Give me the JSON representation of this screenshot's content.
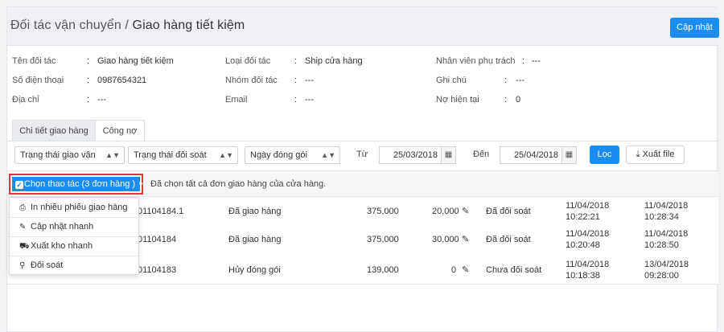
{
  "header": {
    "title_main": "Đối tác vận chuyển",
    "title_sep": " / ",
    "title_sub": "Giao hàng tiết kiệm",
    "update_button": "Cập nhật"
  },
  "info": {
    "partner_name": {
      "label": "Tên đối tác",
      "value": "Giao hàng tiết kiệm"
    },
    "phone": {
      "label": "Số điện thoại",
      "value": "0987654321"
    },
    "address": {
      "label": "Địa chỉ",
      "value": "---"
    },
    "partner_type": {
      "label": "Loại đối tác",
      "value": "Ship cửa hàng"
    },
    "partner_group": {
      "label": "Nhóm đối tác",
      "value": "---"
    },
    "email": {
      "label": "Email",
      "value": "---"
    },
    "staff": {
      "label": "Nhân viên phụ trách",
      "value": "---"
    },
    "note": {
      "label": "Ghi chú",
      "value": "---"
    },
    "debt": {
      "label": "Nợ hiện tại",
      "value": "0"
    },
    "colon": ":"
  },
  "tabs": [
    {
      "label": "Chi tiết giao hàng",
      "active": true
    },
    {
      "label": "Công nợ",
      "active": false
    }
  ],
  "filters": {
    "shipping_status": "Trạng thái giao vận",
    "reconcile_status": "Trạng thái đối soát",
    "pack_date": "Ngày đóng gói",
    "from_label": "Từ",
    "from_date": "25/03/2018",
    "to_label": "Đến",
    "to_date": "25/04/2018",
    "filter_button": "Lọc",
    "export_button": "Xuất file"
  },
  "actions": {
    "choose_label": "Chọn thao tác (3 đơn hàng )",
    "select_all_message": "Đã chọn tất cả đơn giao hàng của cửa hàng.",
    "menu": [
      {
        "label": "In nhiều phiếu giao hàng",
        "icon": "printer-icon"
      },
      {
        "label": "Cập nhật nhanh",
        "icon": "edit-icon"
      },
      {
        "label": "Xuất kho nhanh",
        "icon": "truck-icon"
      },
      {
        "label": "Đối soát",
        "icon": "search-icon"
      }
    ]
  },
  "rows": [
    {
      "code": "01104184.1",
      "status": "Đã giao hàng",
      "amount": "375,000",
      "fee": "20,000",
      "reconcile": "Đã đối soát",
      "date1": "11/04/2018",
      "time1": "10:22:21",
      "date2": "11/04/2018",
      "time2": "10:28:34"
    },
    {
      "code": "01104184",
      "status": "Đã giao hàng",
      "amount": "375,000",
      "fee": "30,000",
      "reconcile": "Đã đối soát",
      "date1": "11/04/2018",
      "time1": "10:20:48",
      "date2": "11/04/2018",
      "time2": "10:28:50"
    },
    {
      "code": "01104183",
      "status": "Hủy đóng gói",
      "amount": "139,000",
      "fee": "0",
      "reconcile": "Chưa đối soát",
      "date1": "11/04/2018",
      "time1": "10:18:38",
      "date2": "13/04/2018",
      "time2": "09:28:00"
    }
  ],
  "colors": {
    "accent": "#1b8cf0",
    "highlight": "#e8333b"
  }
}
